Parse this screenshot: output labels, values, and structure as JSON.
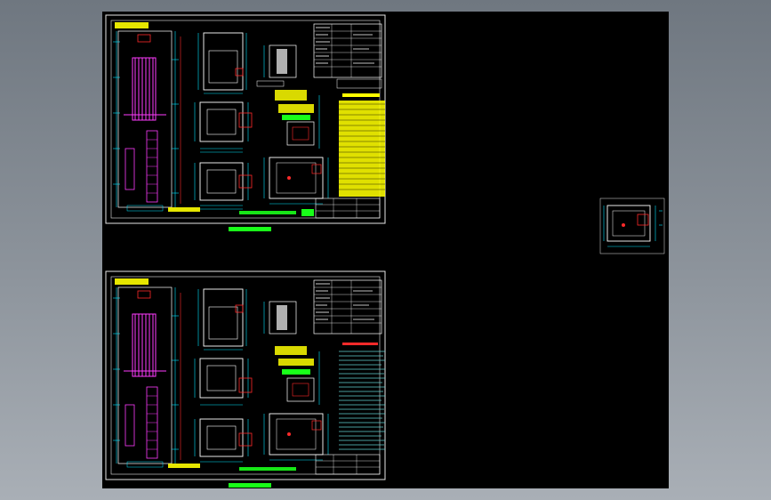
{
  "viewport": {
    "background": "#8a9199",
    "canvas_color": "#000000"
  },
  "colors": {
    "frame": "#e6e6e6",
    "outline": "#ffffff",
    "dimension": "#00e5ff",
    "accent": "#ff2a2a",
    "notes": "#ffff00",
    "rail": "#ff3bff",
    "green": "#19ff19"
  },
  "sheets": [
    {
      "name": "drawing-sheet-1",
      "notes_style": "highlighted"
    },
    {
      "name": "drawing-sheet-2",
      "notes_style": "plain"
    }
  ],
  "detail_view": {
    "name": "pit-detail-view"
  }
}
